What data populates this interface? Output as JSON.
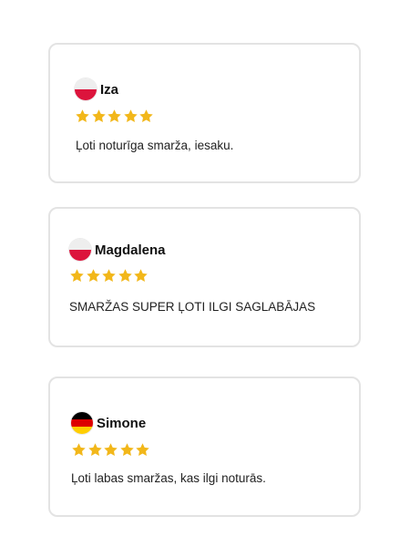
{
  "reviews": [
    {
      "name": "Iza",
      "country_flag": "poland-flag",
      "rating": 5,
      "text": "Ļoti noturīga smarža, iesaku."
    },
    {
      "name": "Magdalena",
      "country_flag": "poland-flag",
      "rating": 5,
      "text": "SMARŽAS SUPER ĻOTI ILGI SAGLABĀJAS"
    },
    {
      "name": "Simone",
      "country_flag": "germany-flag",
      "rating": 5,
      "text": "Ļoti labas smaržas, kas ilgi noturās."
    }
  ],
  "colors": {
    "star": "#f2b71a",
    "card_border": "#e3e3e3",
    "poland_white": "#eeeeee",
    "poland_red": "#dc143c",
    "germany_black": "#000000",
    "germany_red": "#dd0000",
    "germany_gold": "#ffce00"
  }
}
